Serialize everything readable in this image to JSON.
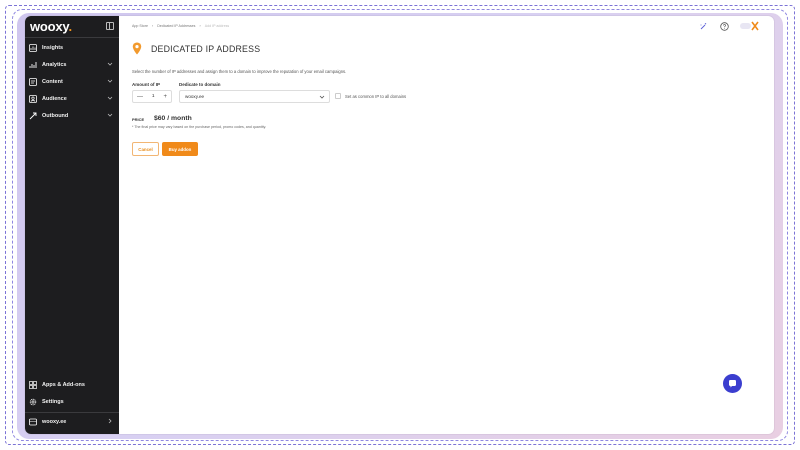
{
  "app": {
    "brand": {
      "name": "wooxy",
      "dot": ".",
      "accent": "#f08a1a"
    },
    "sidebar_bg": "#1d1d1f"
  },
  "sidebar": {
    "collapse_icon": "sidebar-toggle-icon",
    "items": [
      {
        "label": "Insights",
        "icon": "insights-icon",
        "has_submenu": false
      },
      {
        "label": "Analytics",
        "icon": "analytics-icon",
        "has_submenu": true
      },
      {
        "label": "Content",
        "icon": "content-icon",
        "has_submenu": true
      },
      {
        "label": "Audience",
        "icon": "audience-icon",
        "has_submenu": true
      },
      {
        "label": "Outbound",
        "icon": "outbound-icon",
        "has_submenu": true
      }
    ],
    "bottom_items": [
      {
        "label": "Apps & Add-ons",
        "icon": "apps-icon"
      },
      {
        "label": "Settings",
        "icon": "gear-icon"
      }
    ],
    "account": {
      "label": "wooxy.ee",
      "icon": "account-icon"
    }
  },
  "breadcrumb": {
    "items": [
      "App Store",
      "Dedicated IP Addresses",
      "Add IP address"
    ],
    "separator": "›"
  },
  "header": {
    "icons": [
      "wand-icon",
      "help-icon",
      "avatar"
    ]
  },
  "page": {
    "title": "DEDICATED IP ADDRESS",
    "title_icon": "location-pin-icon",
    "description": "Select the number of IP addresses and assign them to a domain to improve the reputation of your email campaigns.",
    "form": {
      "amount_label": "Amount of IP",
      "amount_value": "1",
      "minus": "—",
      "plus": "+",
      "domain_label": "Dedicate to domain",
      "domain_value": "wooxy.ee",
      "common_ip_label": "Set as common IP to all domains"
    },
    "price": {
      "label": "PRICE",
      "value": "$60 / month",
      "note": "* The final price may vary based on the purchase period, promo codes, and quantity."
    },
    "buttons": {
      "cancel": "Cancel",
      "buy": "Buy addon"
    }
  },
  "colors": {
    "accent": "#f08a1a",
    "chat_button": "#3b3ecf"
  }
}
